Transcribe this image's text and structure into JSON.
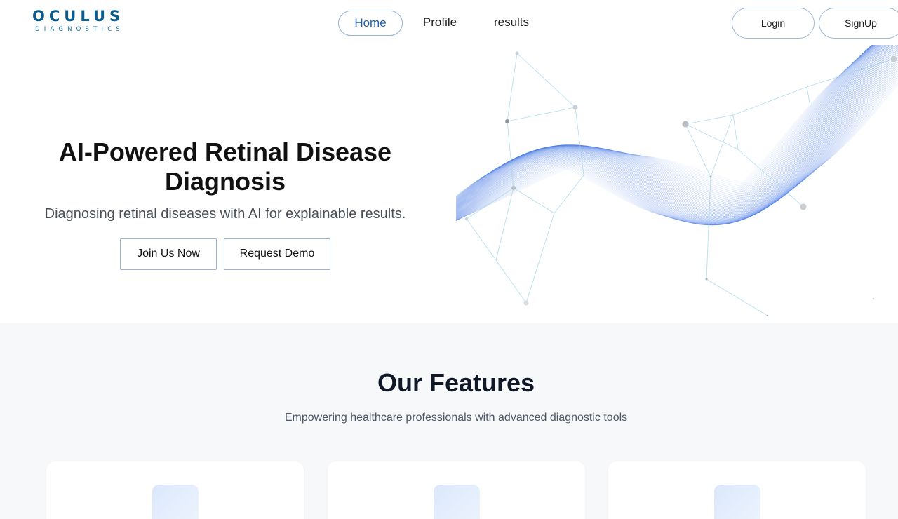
{
  "logo": {
    "main": "OCULUS",
    "sub": "DIAGNOSTICS"
  },
  "nav": {
    "items": [
      {
        "label": "Home",
        "active": true
      },
      {
        "label": "Profile",
        "active": false
      },
      {
        "label": "results",
        "active": false
      }
    ]
  },
  "auth": {
    "login": "Login",
    "signup": "SignUp"
  },
  "hero": {
    "title_line1": "AI-Powered Retinal Disease",
    "title_line2": "Diagnosis",
    "subtitle": "Diagnosing retinal diseases with AI for explainable results.",
    "join_button": "Join Us Now",
    "demo_button": "Request Demo"
  },
  "features": {
    "title": "Our Features",
    "subtitle": "Empowering healthcare professionals with advanced diagnostic tools",
    "cards": [
      {
        "icon": "feature-icon"
      },
      {
        "icon": "feature-icon"
      },
      {
        "icon": "feature-icon"
      }
    ]
  },
  "colors": {
    "brand": "#0a5c8f",
    "accent": "#1f5fa8",
    "wave": "#3b6fe0",
    "section_bg": "#f7f8fa"
  }
}
